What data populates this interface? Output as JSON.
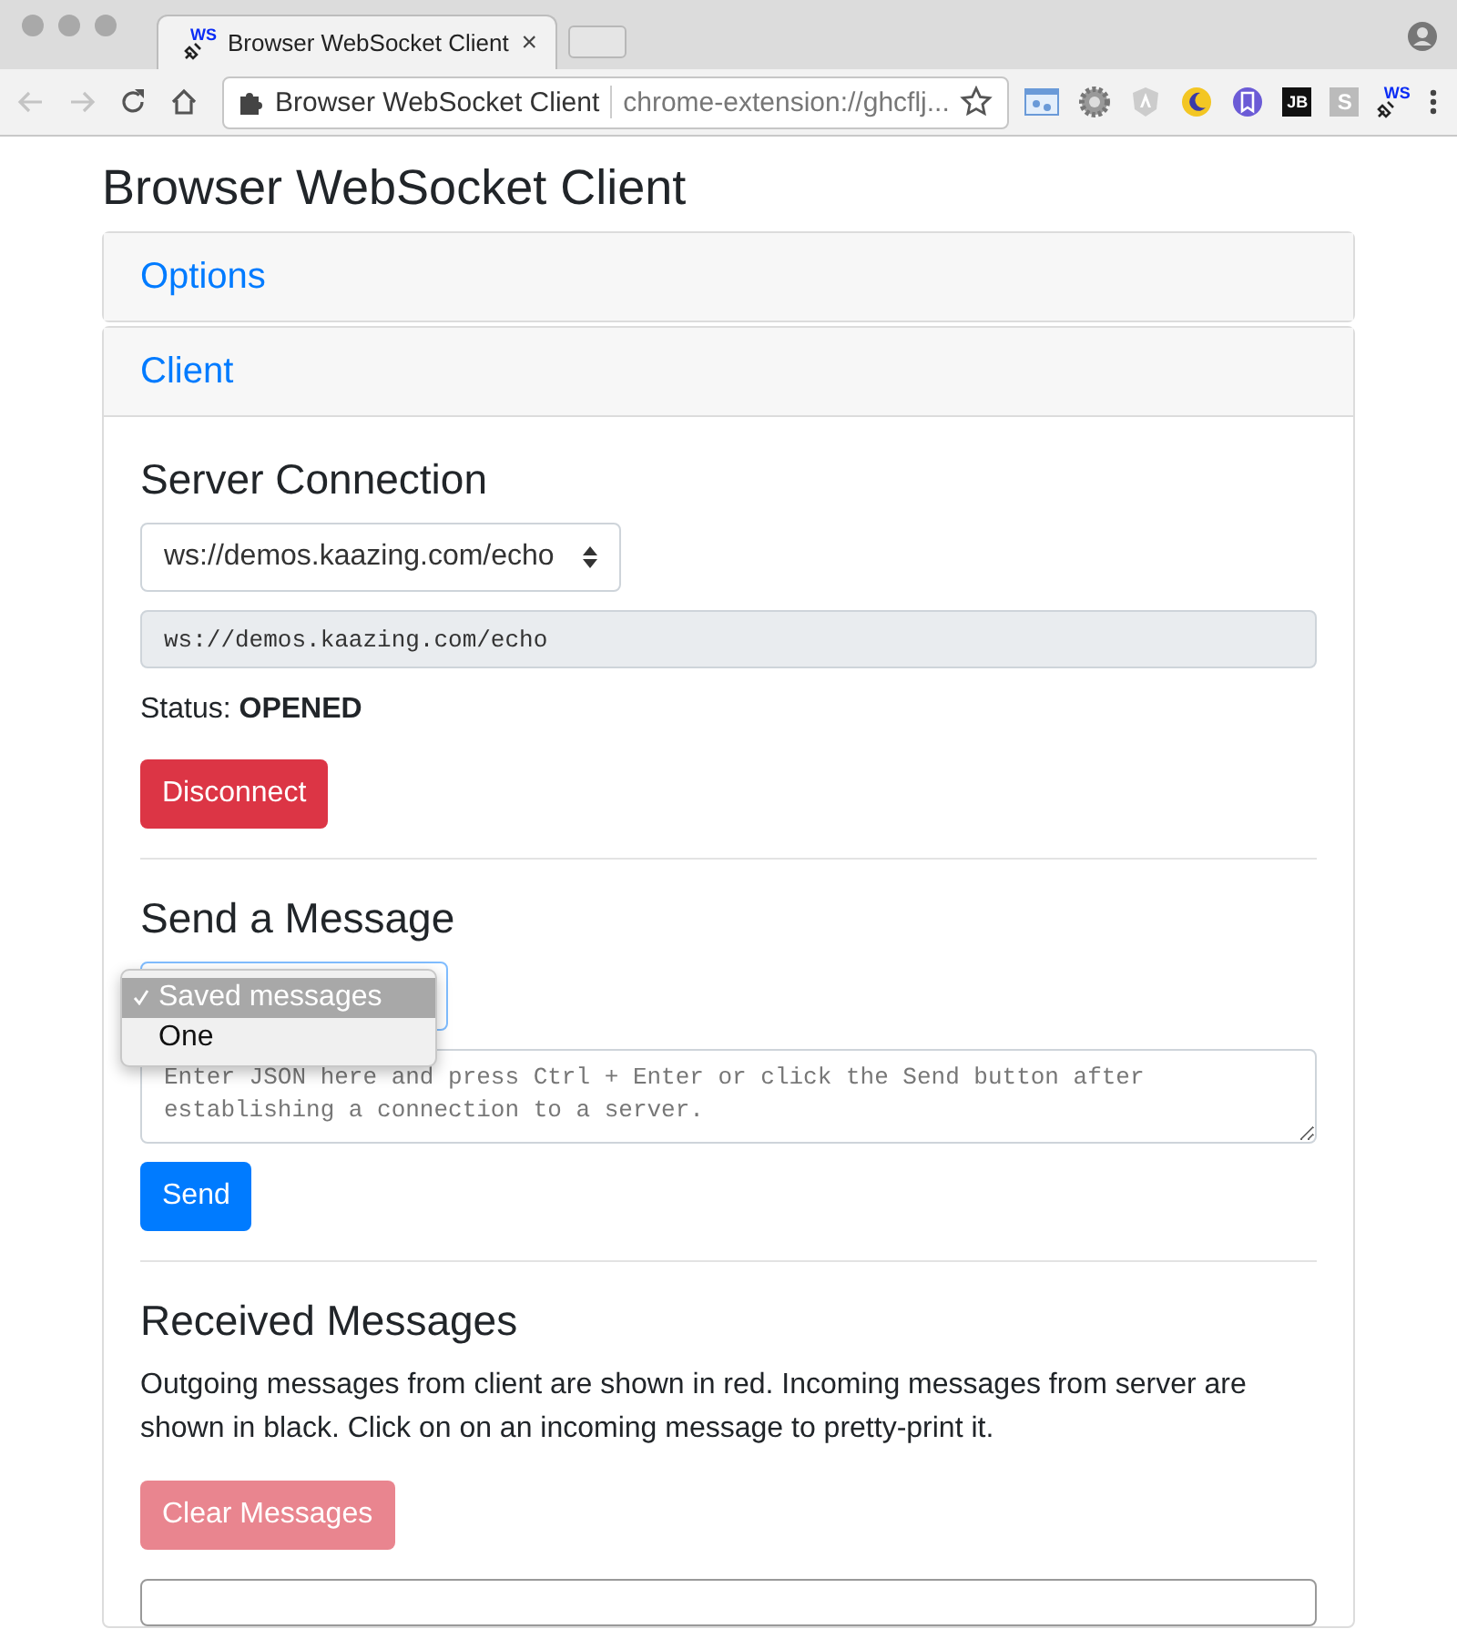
{
  "browser": {
    "tab": {
      "title": "Browser WebSocket Client",
      "favicon_text": "WS",
      "close": "×"
    },
    "address": {
      "page_title": "Browser WebSocket Client",
      "url": "chrome-extension://ghcflj..."
    },
    "extensions": [
      {
        "kind": "window"
      },
      {
        "kind": "gear"
      },
      {
        "kind": "angular"
      },
      {
        "kind": "moon"
      },
      {
        "kind": "bookmark"
      },
      {
        "kind": "dark",
        "label": "JB"
      },
      {
        "kind": "grey",
        "label": "S"
      },
      {
        "kind": "ws",
        "label": "WS"
      }
    ]
  },
  "page": {
    "title": "Browser WebSocket Client",
    "accordion": [
      {
        "label": "Options",
        "expanded": false
      },
      {
        "label": "Client",
        "expanded": true
      }
    ],
    "server_connection": {
      "heading": "Server Connection",
      "select_value": "ws://demos.kaazing.com/echo",
      "url_field": "ws://demos.kaazing.com/echo",
      "status": "Status: **OPENED**",
      "button": "Disconnect"
    },
    "send_message": {
      "heading": "Send a Message",
      "dropdown": {
        "open": true,
        "options": [
          {
            "label": "Saved messages",
            "selected": true
          },
          {
            "label": "One",
            "selected": false
          }
        ]
      },
      "placeholder": "Enter JSON here and press Ctrl + Enter or click the Send button after establishing a connection to a server.",
      "button": "Send"
    },
    "received_messages": {
      "heading": "Received Messages",
      "description": "Outgoing messages from client are shown in red. Incoming messages from server are shown in black. Click on on an incoming message to pretty-print it.",
      "clear_button": {
        "label": "Clear Messages",
        "disabled": true
      }
    }
  }
}
